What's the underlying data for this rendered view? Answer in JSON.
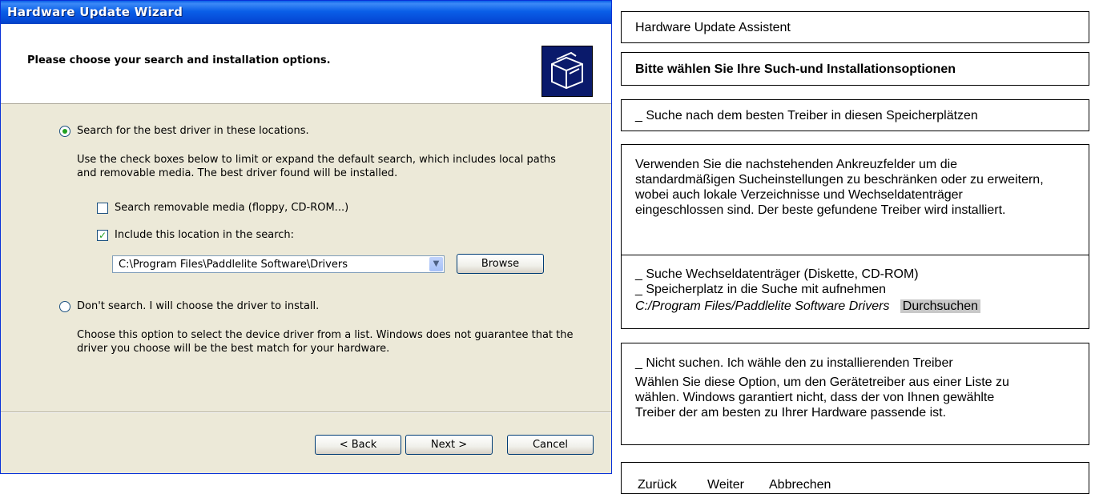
{
  "window": {
    "title": "Hardware Update Wizard",
    "header_title": "Please choose your search and installation options.",
    "header_icon": "hardware-box-icon"
  },
  "options": {
    "search_radio_label": "Search for the best driver in these locations.",
    "search_description": "Use the check boxes below to limit or expand the default search, which includes local paths and removable media. The best driver found will be installed.",
    "removable_media_label": "Search removable media (floppy, CD-ROM...)",
    "include_location_label": "Include this location in the search:",
    "location_value": "C:\\Program Files\\Paddlelite Software\\Drivers",
    "browse_label": "Browse",
    "dont_search_label": "Don't search. I will choose the driver to install.",
    "dont_search_description": "Choose this option to select the device driver from a list.  Windows does not guarantee that the driver you choose will be the best match for your hardware."
  },
  "buttons": {
    "back": "< Back",
    "next": "Next >",
    "cancel": "Cancel"
  },
  "translation": {
    "title": "Hardware Update Assistent",
    "header": "Bitte wählen Sie Ihre Such-und Installationsoptionen",
    "search_radio": "_ Suche nach dem besten Treiber in diesen Speicherplätzen",
    "search_description": "Verwenden Sie die nachstehenden Ankreuzfelder um die standardmäßigen Sucheinstellungen zu beschränken oder zu erweitern, wobei auch lokale Verzeichnisse und Wechseldatenträger eingeschlossen sind. Der beste gefundene Treiber wird installiert.",
    "removable_media": "_ Suche Wechseldatenträger (Diskette, CD-ROM)",
    "include_location": "_ Speicherplatz in die Suche mit aufnehmen",
    "location_path": "C:/Program Files/Paddlelite Software Drivers",
    "browse": "Durchsuchen",
    "dont_search": "_ Nicht suchen. Ich wähle den zu installierenden Treiber",
    "dont_search_description": "Wählen Sie diese Option, um den Gerätetreiber aus einer Liste zu wählen. Windows garantiert nicht, dass der von Ihnen gewählte Treiber der am besten zu Ihrer Hardware passende ist.",
    "back": "Zurück",
    "next": "Weiter",
    "cancel": "Abbrechen"
  }
}
